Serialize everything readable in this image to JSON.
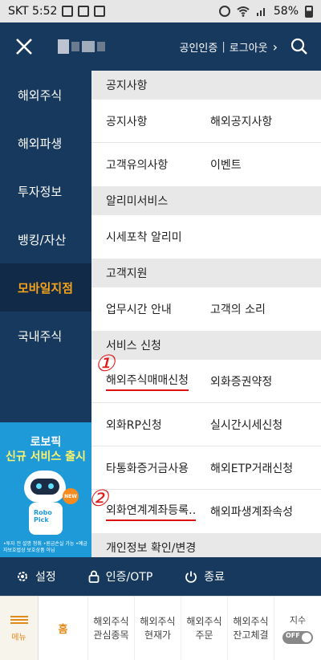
{
  "status_bar": {
    "carrier_time": "SKT 5:52",
    "battery": "58%"
  },
  "header": {
    "login_links": [
      "공인인증",
      "로그아웃"
    ],
    "separator": "|"
  },
  "sidebar": {
    "items": [
      {
        "label": "해외주식"
      },
      {
        "label": "해외파생"
      },
      {
        "label": "투자정보"
      },
      {
        "label": "뱅킹/자산"
      },
      {
        "label": "모바일지점",
        "active": true
      },
      {
        "label": "국내주식"
      }
    ],
    "promo": {
      "line1": "로보픽",
      "line2": "신규 서비스 출시",
      "robot_badge": "Robo Pick",
      "new_badge": "NEW",
      "note": "•투자 전 설명 청취  •원금손실 가능  •예금자보호법상 보호상품 아님"
    }
  },
  "content": {
    "sections": [
      {
        "title": "공지사항",
        "rows": [
          [
            "공지사항",
            "해외공지사항"
          ],
          [
            "고객유의사항",
            "이벤트"
          ]
        ]
      },
      {
        "title": "알리미서비스",
        "rows": [
          [
            "시세포착 알리미",
            ""
          ]
        ]
      },
      {
        "title": "고객지원",
        "rows": [
          [
            "업무시간 안내",
            "고객의 소리"
          ]
        ]
      },
      {
        "title": "서비스 신청",
        "rows": [
          [
            "해외주식매매신청",
            "외화증권약정"
          ],
          [
            "외화RP신청",
            "실시간시세신청"
          ],
          [
            "타통화증거금사용",
            "해외ETP거래신청"
          ],
          [
            "외화연계계좌등록…",
            "해외파생계좌속성"
          ]
        ]
      },
      {
        "title": "개인정보 확인/변경",
        "rows": []
      }
    ]
  },
  "annotations": {
    "one": "①",
    "two": "②"
  },
  "bottom_bar": {
    "settings": "설정",
    "auth": "인증/OTP",
    "exit": "종료"
  },
  "nav": {
    "menu": "메뉴",
    "home": "홈",
    "tabs": [
      [
        "해외주식",
        "관심종목"
      ],
      [
        "해외주식",
        "현재가"
      ],
      [
        "해외주식",
        "주문"
      ],
      [
        "해외주식",
        "잔고체결"
      ]
    ],
    "index": "지수",
    "toggle": "OFF"
  },
  "colors": {
    "navy": "#17395e",
    "accent": "#f6a21a",
    "annotation": "#e01b1b"
  }
}
